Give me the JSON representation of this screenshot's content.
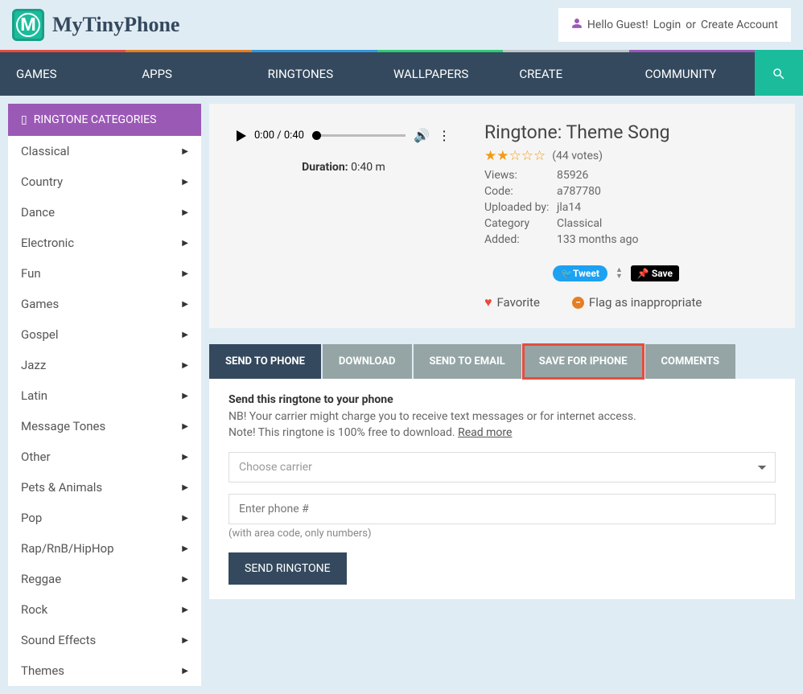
{
  "header": {
    "logo_letter": "M",
    "site_name": "MyTinyPhone",
    "greeting": "Hello Guest!",
    "login_label": "Login",
    "or_label": "or",
    "create_label": "Create Account"
  },
  "nav": {
    "items": [
      "GAMES",
      "APPS",
      "RINGTONES",
      "WALLPAPERS",
      "CREATE",
      "COMMUNITY"
    ]
  },
  "sidebar": {
    "title": "RINGTONE CATEGORIES",
    "items": [
      "Classical",
      "Country",
      "Dance",
      "Electronic",
      "Fun",
      "Games",
      "Gospel",
      "Jazz",
      "Latin",
      "Message Tones",
      "Other",
      "Pets & Animals",
      "Pop",
      "Rap/RnB/HipHop",
      "Reggae",
      "Rock",
      "Sound Effects",
      "Themes"
    ]
  },
  "player": {
    "time": "0:00 / 0:40",
    "duration_label": "Duration:",
    "duration_value": "0:40 m"
  },
  "ringtone": {
    "title": "Ringtone: Theme Song",
    "votes": "(44 votes)",
    "views_label": "Views:",
    "views_value": "85926",
    "code_label": "Code:",
    "code_value": "a787780",
    "uploaded_label": "Uploaded by:",
    "uploaded_value": "jla14",
    "category_label": "Category",
    "category_value": "Classical",
    "added_label": "Added:",
    "added_value": "133 months ago"
  },
  "social": {
    "tweet": "Tweet",
    "save": "Save"
  },
  "actions": {
    "favorite": "Favorite",
    "flag": "Flag as inappropriate"
  },
  "tabs": {
    "items": [
      "SEND TO PHONE",
      "DOWNLOAD",
      "SEND TO EMAIL",
      "SAVE FOR IPHONE",
      "COMMENTS"
    ]
  },
  "form": {
    "title": "Send this ringtone to your phone",
    "note1": "NB! Your carrier might charge you to receive text messages or for internet access.",
    "note2": "Note! This ringtone is 100% free to download.",
    "read_more": "Read more",
    "carrier_placeholder": "Choose carrier",
    "phone_placeholder": "Enter phone #",
    "phone_hint": "(with area code, only numbers)",
    "send_button": "SEND RINGTONE"
  }
}
